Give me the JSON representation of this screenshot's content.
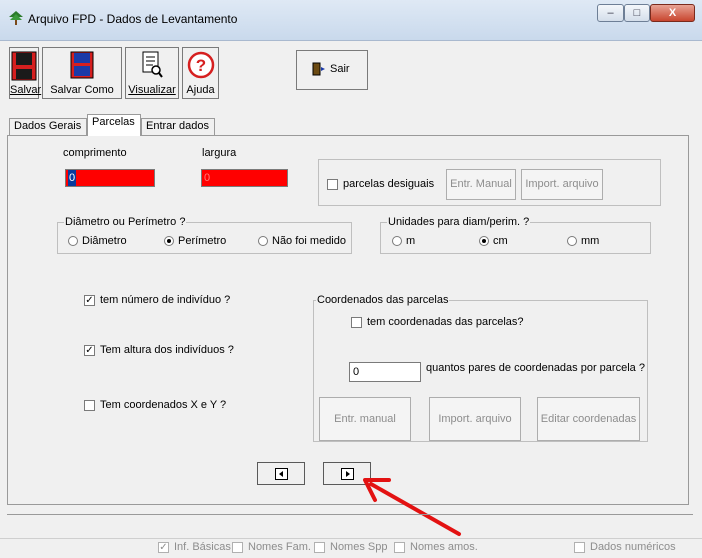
{
  "window": {
    "title": "Arquivo FPD - Dados de Levantamento",
    "minimize": "–",
    "maximize": "□",
    "close": "X"
  },
  "toolbar": {
    "save_label": "Salvar",
    "save_as_label": "Salvar Como",
    "view_label": "Visualizar",
    "help_label": "Ajuda",
    "exit_label": "Sair"
  },
  "tabs": [
    {
      "label": "Dados Gerais"
    },
    {
      "label": "Parcelas"
    },
    {
      "label": "Entrar dados"
    }
  ],
  "parcelas": {
    "comprimento_label": "comprimento",
    "comprimento_value": "0",
    "largura_label": "largura",
    "largura_value": "0",
    "desiguais_label": "parcelas desiguais",
    "entr_manual_label": "Entr. Manual",
    "import_label": "Import. arquivo"
  },
  "diametro": {
    "title": "Diâmetro ou Perímetro ?",
    "opt_diametro": "Diâmetro",
    "opt_perimetro": "Perímetro",
    "opt_nao": "Não foi medido"
  },
  "unidades": {
    "title": "Unidades para diam/perim. ?",
    "opt_m": "m",
    "opt_cm": "cm",
    "opt_mm": "mm"
  },
  "checks": {
    "numero_label": "tem número de indivíduo ?",
    "altura_label": "Tem altura dos indivíduos ?",
    "coord_xy_label": "Tem coordenados X e Y ?"
  },
  "coordenadas": {
    "title": "Coordenados das parcelas",
    "tem_label": "tem coordenadas das parcelas?",
    "pares_value": "0",
    "pares_label": "quantos pares de coordenadas por parcela ?",
    "entr_manual_label": "Entr. manual",
    "import_label": "Import. arquivo",
    "editar_label": "Editar coordenadas"
  },
  "status": {
    "inf_basicas": "Inf. Básicas",
    "nomes_fam": "Nomes Fam.",
    "nomes_spp": "Nomes Spp",
    "nomes_amos": "Nomes amos.",
    "dados_numericos": "Dados numéricos"
  },
  "colors": {
    "accent_red": "#ff0000",
    "arrow_red": "#e31212"
  }
}
